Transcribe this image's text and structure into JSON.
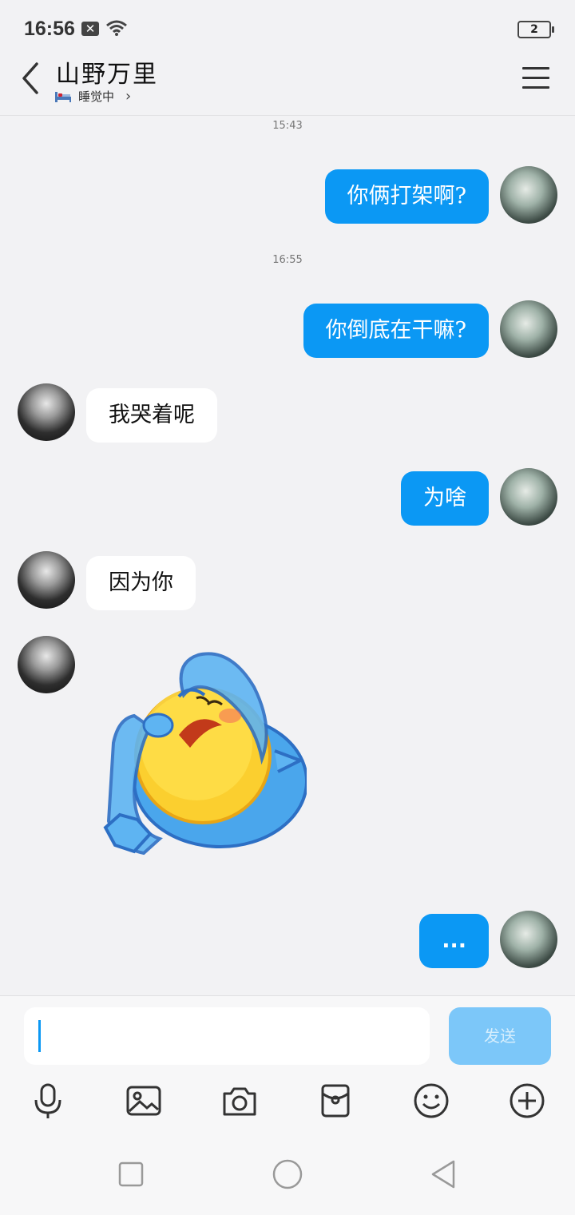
{
  "status_bar": {
    "time": "16:56",
    "battery": "2"
  },
  "header": {
    "contact_name": "山野万里",
    "contact_status": "睡觉中",
    "status_icon": "bed-icon",
    "menu_icon": "menu-icon"
  },
  "messages": [
    {
      "type": "time",
      "text": "15:43"
    },
    {
      "type": "out",
      "text": "你俩打架啊?"
    },
    {
      "type": "time",
      "text": "16:55"
    },
    {
      "type": "out",
      "text": "你倒底在干嘛?"
    },
    {
      "type": "in",
      "text": "我哭着呢"
    },
    {
      "type": "out",
      "text": "为啥"
    },
    {
      "type": "in",
      "text": "因为你"
    },
    {
      "type": "in-sticker",
      "sticker": "crying-emoji-sticker"
    },
    {
      "type": "out",
      "text": "..."
    }
  ],
  "input": {
    "value": "",
    "send_label": "发送"
  },
  "toolbar": [
    "microphone-icon",
    "image-icon",
    "camera-icon",
    "red-packet-icon",
    "emoji-icon",
    "plus-icon"
  ],
  "colors": {
    "bubble_out": "#0b98f4",
    "bubble_in": "#ffffff",
    "send_disabled": "#7cc7f9",
    "background": "#f2f2f4"
  }
}
